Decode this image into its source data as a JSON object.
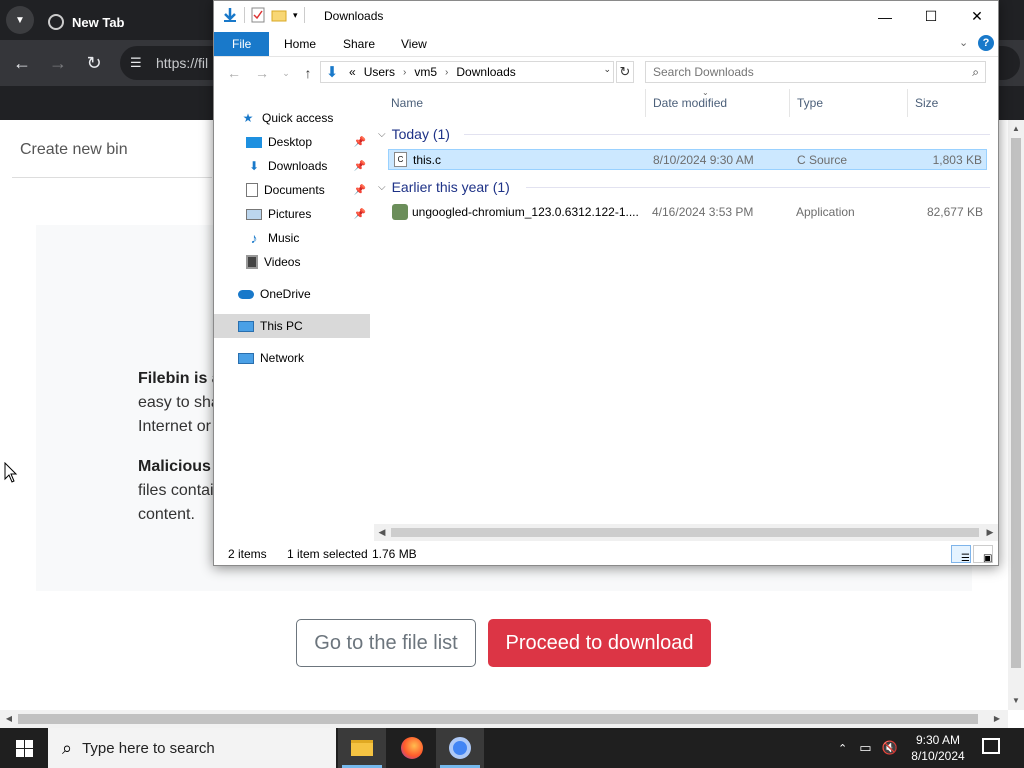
{
  "browser": {
    "tab_title": "New Tab",
    "url_partial": "https://fil",
    "page": {
      "create_bin": "Create new bin",
      "p1_lines": [
        "Filebin is a",
        "easy to sha",
        "Internet or"
      ],
      "p2_lines": [
        "Malicious",
        "files contai",
        "content."
      ],
      "btn_file_list": "Go to the file list",
      "btn_download": "Proceed to download"
    }
  },
  "explorer": {
    "title": "Downloads",
    "ribbon_tabs": [
      "File",
      "Home",
      "Share",
      "View"
    ],
    "breadcrumb": [
      "«",
      "Users",
      "vm5",
      "Downloads"
    ],
    "search_placeholder": "Search Downloads",
    "nav": {
      "quick_access": "Quick access",
      "desktop": "Desktop",
      "downloads": "Downloads",
      "documents": "Documents",
      "pictures": "Pictures",
      "music": "Music",
      "videos": "Videos",
      "onedrive": "OneDrive",
      "this_pc": "This PC",
      "network": "Network"
    },
    "columns": [
      "Name",
      "Date modified",
      "Type",
      "Size"
    ],
    "groups": [
      {
        "label": "Today (1)",
        "files": [
          {
            "name": "this.c",
            "date": "8/10/2024 9:30 AM",
            "type": "C Source",
            "size": "1,803 KB",
            "selected": true
          }
        ]
      },
      {
        "label": "Earlier this year (1)",
        "files": [
          {
            "name": "ungoogled-chromium_123.0.6312.122-1....",
            "date": "4/16/2024 3:53 PM",
            "type": "Application",
            "size": "82,677 KB",
            "selected": false
          }
        ]
      }
    ],
    "status": {
      "items": "2 items",
      "selected": "1 item selected",
      "size": "1.76 MB"
    }
  },
  "taskbar": {
    "search_text": "Type here to search",
    "time": "9:30 AM",
    "date": "8/10/2024"
  },
  "colors": {
    "accent": "#1979ca",
    "selection": "#cce8ff",
    "download_button": "#dc3545",
    "group_header": "#1e3287"
  }
}
